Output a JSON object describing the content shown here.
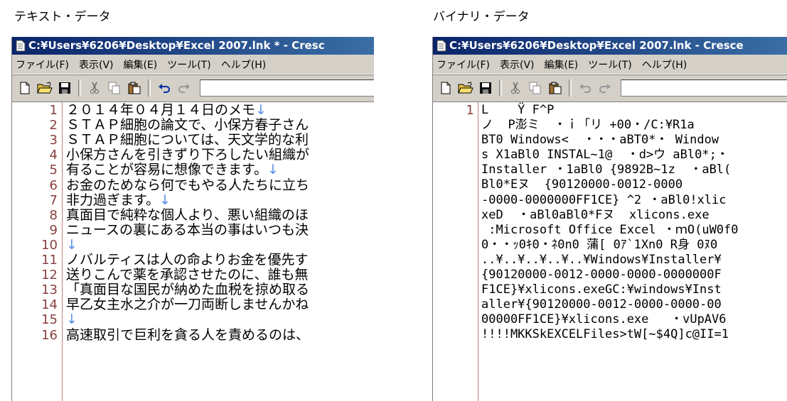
{
  "labels": {
    "text_view": "テキスト・データ",
    "binary_view": "バイナリ・データ"
  },
  "text_window": {
    "title": "C:¥Users¥6206¥Desktop¥Excel 2007.lnk * - Cresc",
    "menu": [
      "ファイル(F)",
      "表示(V)",
      "編集(E)",
      "ツール(T)",
      "ヘルプ(H)"
    ],
    "lines": [
      {
        "num": "1",
        "text": "２０１４年０４月１４日のメモ",
        "eol": "↓"
      },
      {
        "num": "2",
        "text": "ＳＴＡＰ細胞の論文で、小保方春子さん",
        "eol": ""
      },
      {
        "num": "3",
        "text": "ＳＴＡＰ細胞については、天文学的な利",
        "eol": ""
      },
      {
        "num": "4",
        "text": "小保方さんを引きずり下ろしたい組織が",
        "eol": ""
      },
      {
        "num": "5",
        "text": "有ることが容易に想像できます。",
        "eol": "↓"
      },
      {
        "num": "6",
        "text": "お金のためなら何でもやる人たちに立ち",
        "eol": ""
      },
      {
        "num": "7",
        "text": "非力過ぎます。",
        "eol": "↓"
      },
      {
        "num": "8",
        "text": "真面目で純粋な個人より、悪い組織のほ",
        "eol": ""
      },
      {
        "num": "9",
        "text": "ニュースの裏にある本当の事はいつも決",
        "eol": ""
      },
      {
        "num": "10",
        "text": "",
        "eol": "↓"
      },
      {
        "num": "11",
        "text": "ノバルティスは人の命よりお金を優先す",
        "eol": ""
      },
      {
        "num": "12",
        "text": "送りこんで薬を承認させたのに、誰も無",
        "eol": ""
      },
      {
        "num": "13",
        "text": "「真面目な国民が納めた血税を掠め取る",
        "eol": ""
      },
      {
        "num": "14",
        "text": "早乙女主水之介が一刀両断しませんかね",
        "eol": ""
      },
      {
        "num": "15",
        "text": "",
        "eol": "↓"
      },
      {
        "num": "16",
        "text": "高速取引で巨利を貪る人を責めるのは、",
        "eol": ""
      }
    ]
  },
  "binary_window": {
    "title": "C:¥Users¥6206¥Desktop¥Excel 2007.lnk - Cresce",
    "menu": [
      "ファイル(F)",
      "表示(V)",
      "編集(E)",
      "ツール(T)",
      "ヘルプ(H)"
    ],
    "line_number": "1",
    "lines": [
      "L    Ÿ F^P",
      "ノ  P澎ミ  ・ｉ「リ +00・/C:¥R1a",
      "BT0 Windows<  ・・・aBT0*・ Window",
      "s X1aBl0 INSTAL~1@  ・d>ウ aBl0*;・",
      "Installer ・1aBl0 {9892B~1z  ・aBl(",
      "Bl0*Eヌ  {90120000-0012-0000",
      "-0000-0000000FF1CE} ^2 ・aBl0!xlic",
      "xeD  ・aBl0aBl0*Fヌ  xlicons.exe",
      " :Microsoft Office Excel ・ｍO(uW0f0",
      "0・・ｯ0ｷ0・ﾈ0n0 蒲[ 0ｱ`1Xn0 R身 0ﾇ0",
      "..¥..¥..¥..¥..¥Windows¥Installer¥",
      "{90120000-0012-0000-0000-0000000F",
      "F1CE}¥xlicons.exeGC:¥windows¥Inst",
      "aller¥{90120000-0012-0000-0000-00",
      "00000FF1CE}¥xlicons.exe   ・vUpAV6",
      "!!!!MKKSkEXCELFiles>tW[~$4Q]c@II=1"
    ]
  },
  "colors": {
    "title_bar": "#0a246a",
    "line_number": "#8a4040",
    "eol_mark": "#5b8ee6"
  },
  "toolbar_icons": [
    "new-file-icon",
    "open-folder-icon",
    "save-icon",
    "cut-icon",
    "copy-icon",
    "paste-icon",
    "undo-icon",
    "redo-icon"
  ]
}
